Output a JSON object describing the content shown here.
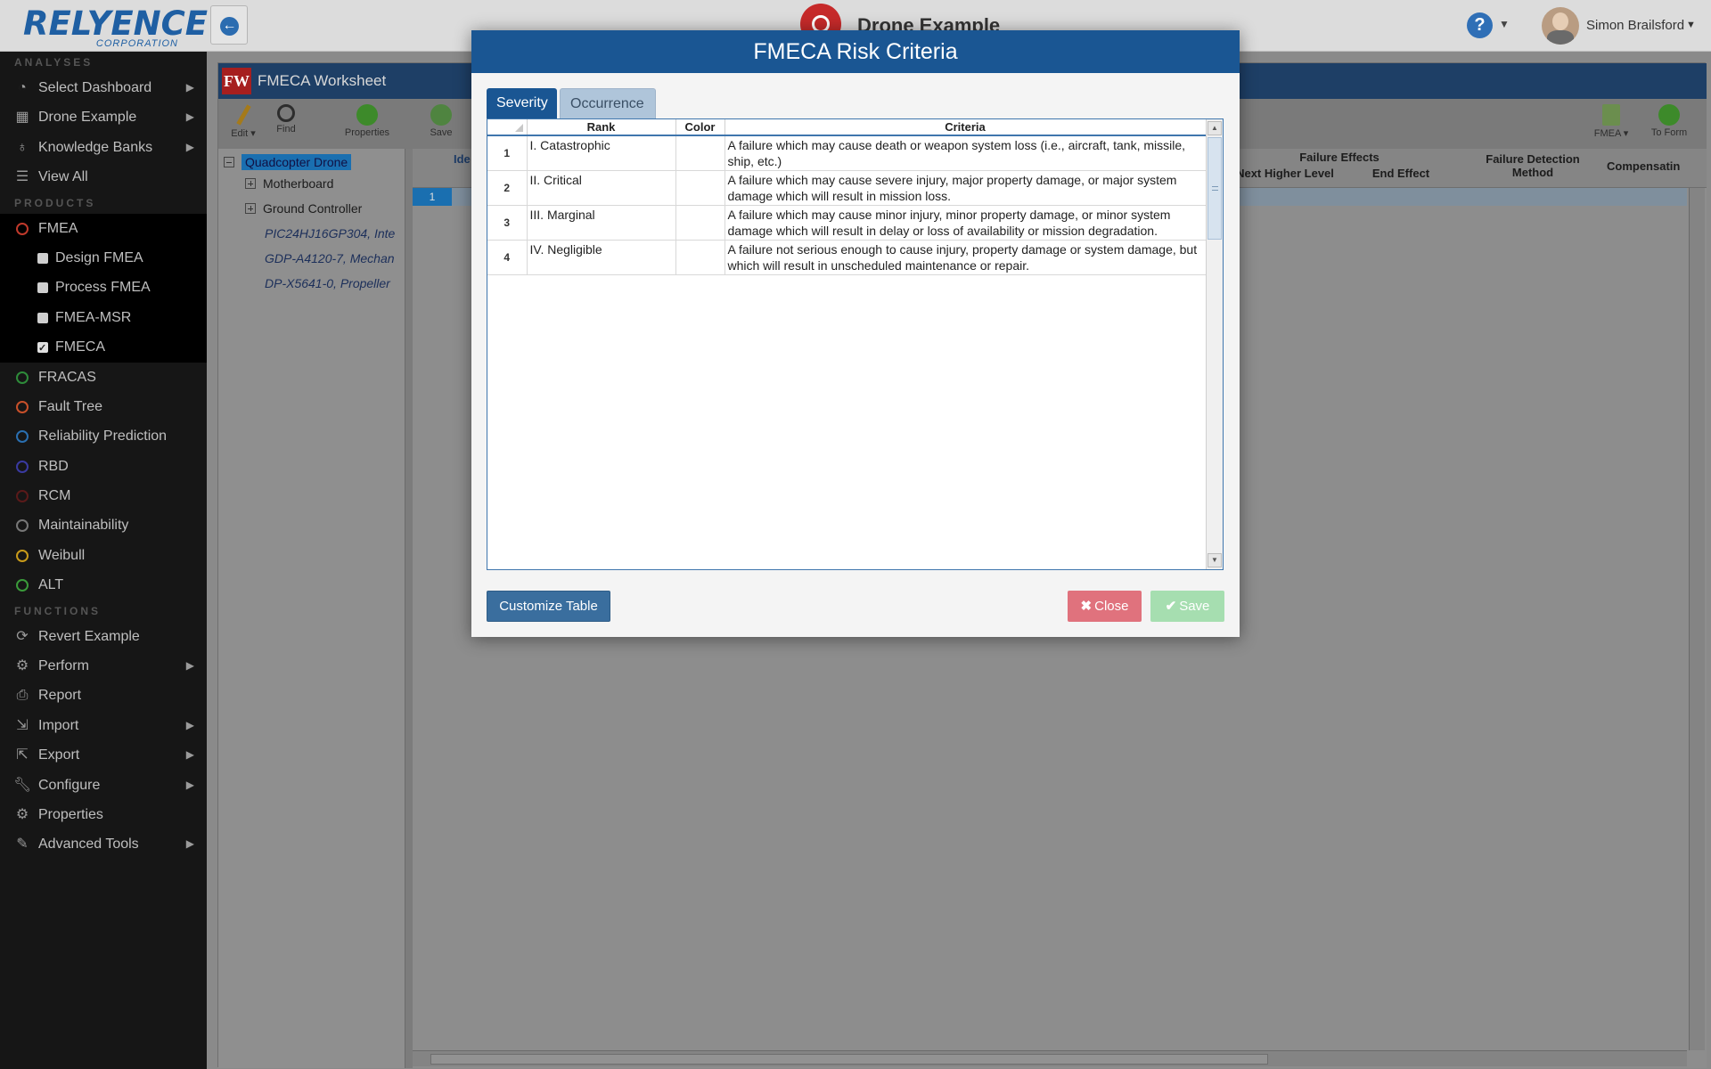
{
  "header": {
    "logo_main": "RELYENCE",
    "logo_sub": "CORPORATION",
    "project_title": "Drone Example",
    "help_label": "?",
    "user_name": "Simon Brailsford"
  },
  "sidebar": {
    "sections": [
      {
        "heading": "ANALYSES",
        "items": [
          {
            "label": "Select Dashboard",
            "icon": "dashboard-icon",
            "arrow": true
          },
          {
            "label": "Drone Example",
            "icon": "building-icon",
            "arrow": true
          },
          {
            "label": "Knowledge Banks",
            "icon": "lightbulb-icon",
            "arrow": true
          },
          {
            "label": "View All",
            "icon": "list-icon",
            "arrow": false
          }
        ]
      },
      {
        "heading": "PRODUCTS",
        "items": [
          {
            "label": "FMEA",
            "ring_color": "#c0392b"
          },
          {
            "label": "Design FMEA",
            "sub": true
          },
          {
            "label": "Process FMEA",
            "sub": true
          },
          {
            "label": "FMEA-MSR",
            "sub": true
          },
          {
            "label": "FMECA",
            "sub": true,
            "checked": true
          },
          {
            "label": "FRACAS",
            "ring_color": "#2e8b3a"
          },
          {
            "label": "Fault Tree",
            "ring_color": "#c8502a"
          },
          {
            "label": "Reliability Prediction",
            "ring_color": "#2a6fb0"
          },
          {
            "label": "RBD",
            "ring_color": "#3a3aa0"
          },
          {
            "label": "RCM",
            "ring_color": "#5a1a1a"
          },
          {
            "label": "Maintainability",
            "ring_color": "#777777"
          },
          {
            "label": "Weibull",
            "ring_color": "#c89a1a"
          },
          {
            "label": "ALT",
            "ring_color": "#3a9a3a"
          }
        ]
      },
      {
        "heading": "FUNCTIONS",
        "items": [
          {
            "label": "Revert Example",
            "icon": "refresh-icon",
            "arrow": false
          },
          {
            "label": "Perform",
            "icon": "gears-icon",
            "arrow": true
          },
          {
            "label": "Report",
            "icon": "printer-icon",
            "arrow": false
          },
          {
            "label": "Import",
            "icon": "import-icon",
            "arrow": true
          },
          {
            "label": "Export",
            "icon": "export-icon",
            "arrow": true
          },
          {
            "label": "Configure",
            "icon": "wrench-icon",
            "arrow": true
          },
          {
            "label": "Properties",
            "icon": "gear-icon",
            "arrow": false
          },
          {
            "label": "Advanced Tools",
            "icon": "magic-wand-icon",
            "arrow": true
          }
        ]
      }
    ]
  },
  "worksheet": {
    "badge": "FW",
    "title": "FMECA Worksheet",
    "toolbar": {
      "edit": "Edit",
      "find": "Find",
      "properties": "Properties",
      "save": "Save",
      "fmea": "FMEA",
      "to_form": "To Form"
    },
    "tree": {
      "root": "Quadcopter Drone",
      "children": [
        "Motherboard",
        "Ground Controller"
      ],
      "leaves": [
        "PIC24HJ16GP304, Inte",
        "GDP-A4120-7, Mechan",
        "DP-X5641-0, Propeller"
      ]
    },
    "grid": {
      "col_id": "Ide",
      "failure_effects": "Failure Effects",
      "next_higher_level": "Next Higher Level",
      "end_effect": "End Effect",
      "failure_detection_method": "Failure Detection Method",
      "compensating": "Compensatin",
      "row_number": "1"
    }
  },
  "modal": {
    "title": "FMECA Risk Criteria",
    "tabs": [
      {
        "label": "Severity",
        "active": true
      },
      {
        "label": "Occurrence",
        "active": false
      }
    ],
    "columns": [
      "Rank",
      "Color",
      "Criteria"
    ],
    "rows": [
      {
        "num": "1",
        "rank": "I. Catastrophic",
        "color": "",
        "criteria": "A failure which may cause death or weapon system loss (i.e., aircraft, tank, missile, ship, etc.)"
      },
      {
        "num": "2",
        "rank": "II. Critical",
        "color": "",
        "criteria": "A failure which may cause severe injury, major property damage, or major system damage which will result in mission loss."
      },
      {
        "num": "3",
        "rank": "III. Marginal",
        "color": "",
        "criteria": "A failure which may cause minor injury, minor property damage, or minor system damage which will result in delay or loss of availability or mission degradation."
      },
      {
        "num": "4",
        "rank": "IV. Negligible",
        "color": "",
        "criteria": "A failure not serious enough to cause injury, property damage or system damage, but which will result in unscheduled maintenance or repair."
      }
    ],
    "buttons": {
      "customize": "Customize Table",
      "close": "Close",
      "save": "Save"
    }
  }
}
